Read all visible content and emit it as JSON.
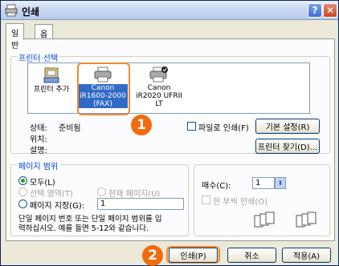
{
  "window": {
    "title": "인쇄",
    "help_glyph": "?",
    "close_glyph": "✕"
  },
  "tabs": [
    {
      "label": "일반"
    },
    {
      "label": "옵션"
    }
  ],
  "printer_group": {
    "legend": "프린터 선택",
    "items": [
      {
        "label": "프린터 추가",
        "icon": "add-printer-icon"
      },
      {
        "label_lines": [
          "Canon",
          "iR1600-2000",
          "(FAX)"
        ],
        "icon": "printer-icon",
        "selected": true
      },
      {
        "label_lines": [
          "Canon",
          "iR2020 UFRII",
          "LT"
        ],
        "icon": "default-printer-icon"
      }
    ],
    "status_label": "상태:",
    "status_value": "준비됨",
    "location_label": "위치:",
    "comment_label": "설명:",
    "print_to_file_label": "파일로 인쇄(F)",
    "preferences_button": "기본 설정(R)",
    "find_printer_button": "프린터 찾기(D)..."
  },
  "page_range": {
    "legend": "페이지 범위",
    "all_label": "모두(L)",
    "selection_label": "선택 영역(T)",
    "current_page_label": "현재 페이지(U)",
    "pages_label": "페이지 지정(G):",
    "pages_value": "1",
    "hint_line1": "단일 페이지 번호 또는 단일 페이지 범위를 입",
    "hint_line2": "력하십시오. 예를 들면 5-12와 같습니다."
  },
  "copies": {
    "label": "매수(C):",
    "value": "1",
    "collate_label": "한 부씩 인쇄(O)"
  },
  "footer": {
    "print_button": "인쇄(P)",
    "cancel_button": "취소",
    "apply_button": "적용(A)"
  },
  "callouts": {
    "one": "1",
    "two": "2"
  },
  "colors": {
    "callout": "#f26b0c",
    "legend": "#0046d5",
    "selection": "#316ac5"
  }
}
